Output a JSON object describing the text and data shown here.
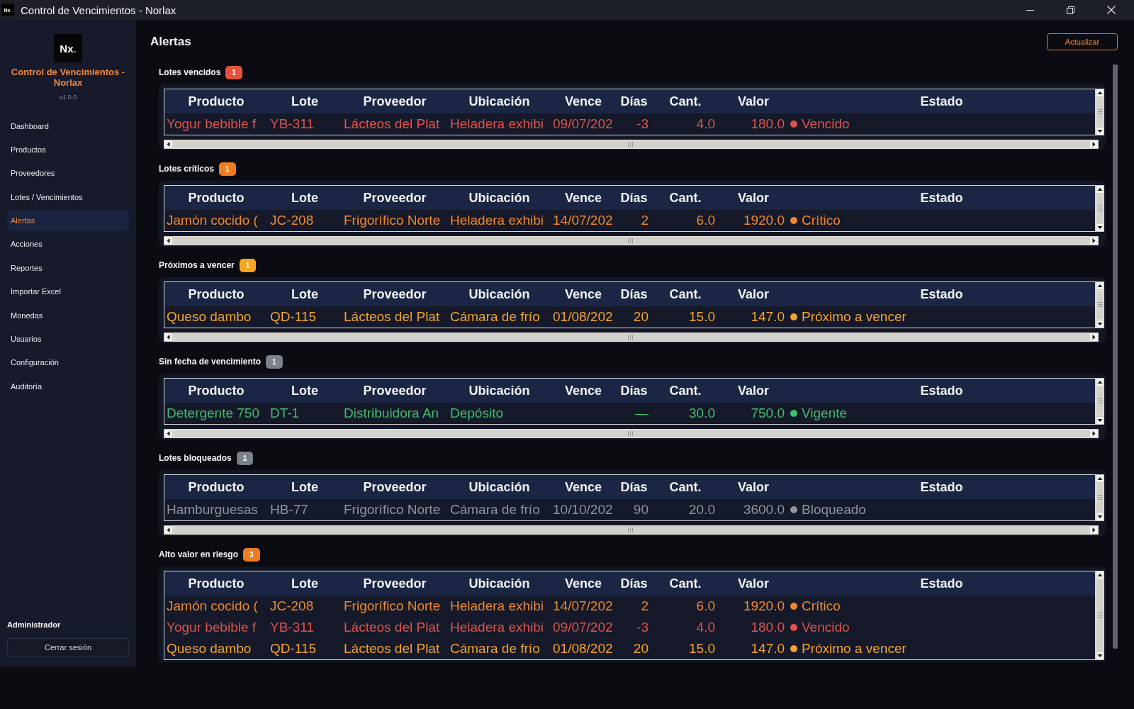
{
  "title_bar": {
    "logo": {
      "letters": "Nx",
      "dot": "."
    },
    "title": "Control de Vencimientos - Norlax"
  },
  "sidebar": {
    "logo": {
      "letters": "Nx",
      "dot": "."
    },
    "app_name": "Control de Vencimientos - Norlax",
    "version": "v1.0.0",
    "items": [
      {
        "label": "Dashboard",
        "selected": false
      },
      {
        "label": "Productos",
        "selected": false
      },
      {
        "label": "Proveedores",
        "selected": false
      },
      {
        "label": "Lotes / Vencimientos",
        "selected": false
      },
      {
        "label": "Alertas",
        "selected": true
      },
      {
        "label": "Acciones",
        "selected": false
      },
      {
        "label": "Reportes",
        "selected": false
      },
      {
        "label": "Importar Excel",
        "selected": false
      },
      {
        "label": "Monedas",
        "selected": false
      },
      {
        "label": "Usuarios",
        "selected": false
      },
      {
        "label": "Configuración",
        "selected": false
      },
      {
        "label": "Auditoría",
        "selected": false
      }
    ],
    "user": "Administrador",
    "logout_button": "Cerrar sesión"
  },
  "main": {
    "title": "Alertas",
    "refresh_button": "Actualizar",
    "sections": [
      {
        "title": "Lotes vencidos",
        "count": "1",
        "color": "#e5533d",
        "columns": [
          "Producto",
          "Lote",
          "Proveedor",
          "Ubicación",
          "Vence",
          "Días",
          "Cant.",
          "Valor",
          "Estado"
        ],
        "rows": [
          {
            "product": "Yogur bebible f",
            "lot": "YB-311",
            "supplier": "Lácteos del Plat",
            "location": "Heladera exhibi",
            "expires": "09/07/202",
            "days": "-3",
            "quantity": "4.0",
            "value": "180.0",
            "status": "Vencido",
            "color": "#e0534a"
          }
        ]
      },
      {
        "title": "Lotes críticos",
        "count": "1",
        "color": "#ee7d22",
        "columns": [
          "Producto",
          "Lote",
          "Proveedor",
          "Ubicación",
          "Vence",
          "Días",
          "Cant.",
          "Valor",
          "Estado"
        ],
        "rows": [
          {
            "product": "Jamón cocido (",
            "lot": "JC-208",
            "supplier": "Frigorífico Norte",
            "location": "Heladera exhibi",
            "expires": "14/07/202",
            "days": "2",
            "quantity": "6.0",
            "value": "1920.0",
            "status": "Crítico",
            "color": "#ef872e"
          }
        ]
      },
      {
        "title": "Próximos a vencer",
        "count": "1",
        "color": "#f5a623",
        "columns": [
          "Producto",
          "Lote",
          "Proveedor",
          "Ubicación",
          "Vence",
          "Días",
          "Cant.",
          "Valor",
          "Estado"
        ],
        "rows": [
          {
            "product": "Queso dambo",
            "lot": "QD-115",
            "supplier": "Lácteos del Plat",
            "location": "Cámara de frío",
            "expires": "01/08/202",
            "days": "20",
            "quantity": "15.0",
            "value": "147.0",
            "status": "Próximo a vencer",
            "color": "#f3a32f"
          }
        ]
      },
      {
        "title": "Sin fecha de vencimiento",
        "count": "1",
        "color": "#7b8289",
        "columns": [
          "Producto",
          "Lote",
          "Proveedor",
          "Ubicación",
          "Vence",
          "Días",
          "Cant.",
          "Valor",
          "Estado"
        ],
        "rows": [
          {
            "product": "Detergente 750",
            "lot": "DT-1",
            "supplier": "Distribuidora An",
            "location": "Depósito",
            "days": "—",
            "quantity": "30.0",
            "value": "750.0",
            "status": "Vigente",
            "color": "#3fbf6c"
          }
        ]
      },
      {
        "title": "Lotes bloqueados",
        "count": "1",
        "color": "#7b8289",
        "columns": [
          "Producto",
          "Lote",
          "Proveedor",
          "Ubicación",
          "Vence",
          "Días",
          "Cant.",
          "Valor",
          "Estado"
        ],
        "rows": [
          {
            "product": "Hamburguesas",
            "lot": "HB-77",
            "supplier": "Frigorífico Norte",
            "location": "Cámara de frío",
            "expires": "10/10/202",
            "days": "90",
            "quantity": "20.0",
            "value": "3600.0",
            "status": "Bloqueado",
            "color": "#8f949c"
          }
        ]
      },
      {
        "title": "Alto valor en riesgo",
        "count": "3",
        "color": "#ee7d22",
        "columns": [
          "Producto",
          "Lote",
          "Proveedor",
          "Ubicación",
          "Vence",
          "Días",
          "Cant.",
          "Valor",
          "Estado"
        ],
        "rows": [
          {
            "product": "Jamón cocido (",
            "lot": "JC-208",
            "supplier": "Frigorífico Norte",
            "location": "Heladera exhibi",
            "expires": "14/07/202",
            "days": "2",
            "quantity": "6.0",
            "value": "1920.0",
            "status": "Crítico",
            "color": "#ef872e"
          },
          {
            "product": "Yogur bebible f",
            "lot": "YB-311",
            "supplier": "Lácteos del Plat",
            "location": "Heladera exhibi",
            "expires": "09/07/202",
            "days": "-3",
            "quantity": "4.0",
            "value": "180.0",
            "status": "Vencido",
            "color": "#e0534a"
          },
          {
            "product": "Queso dambo",
            "lot": "QD-115",
            "supplier": "Lácteos del Plat",
            "location": "Cámara de frío",
            "expires": "01/08/202",
            "days": "20",
            "quantity": "15.0",
            "value": "147.0",
            "status": "Próximo a vencer",
            "color": "#f3a32f"
          }
        ]
      }
    ]
  }
}
